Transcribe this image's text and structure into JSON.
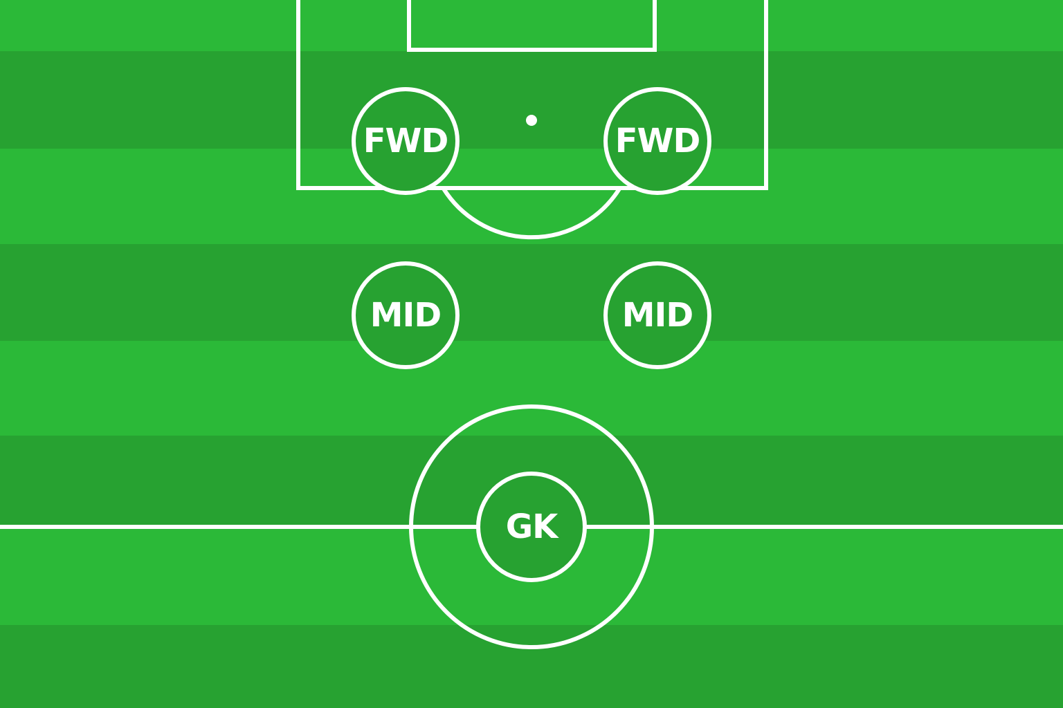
{
  "pitch": {
    "colors": {
      "grass_light": "#2bb938",
      "grass_dark": "#27a231",
      "line": "#ffffff"
    }
  },
  "players": [
    {
      "id": "fwd-left",
      "label": "FWD"
    },
    {
      "id": "fwd-right",
      "label": "FWD"
    },
    {
      "id": "mid-left",
      "label": "MID"
    },
    {
      "id": "mid-right",
      "label": "MID"
    },
    {
      "id": "gk",
      "label": "GK"
    }
  ]
}
